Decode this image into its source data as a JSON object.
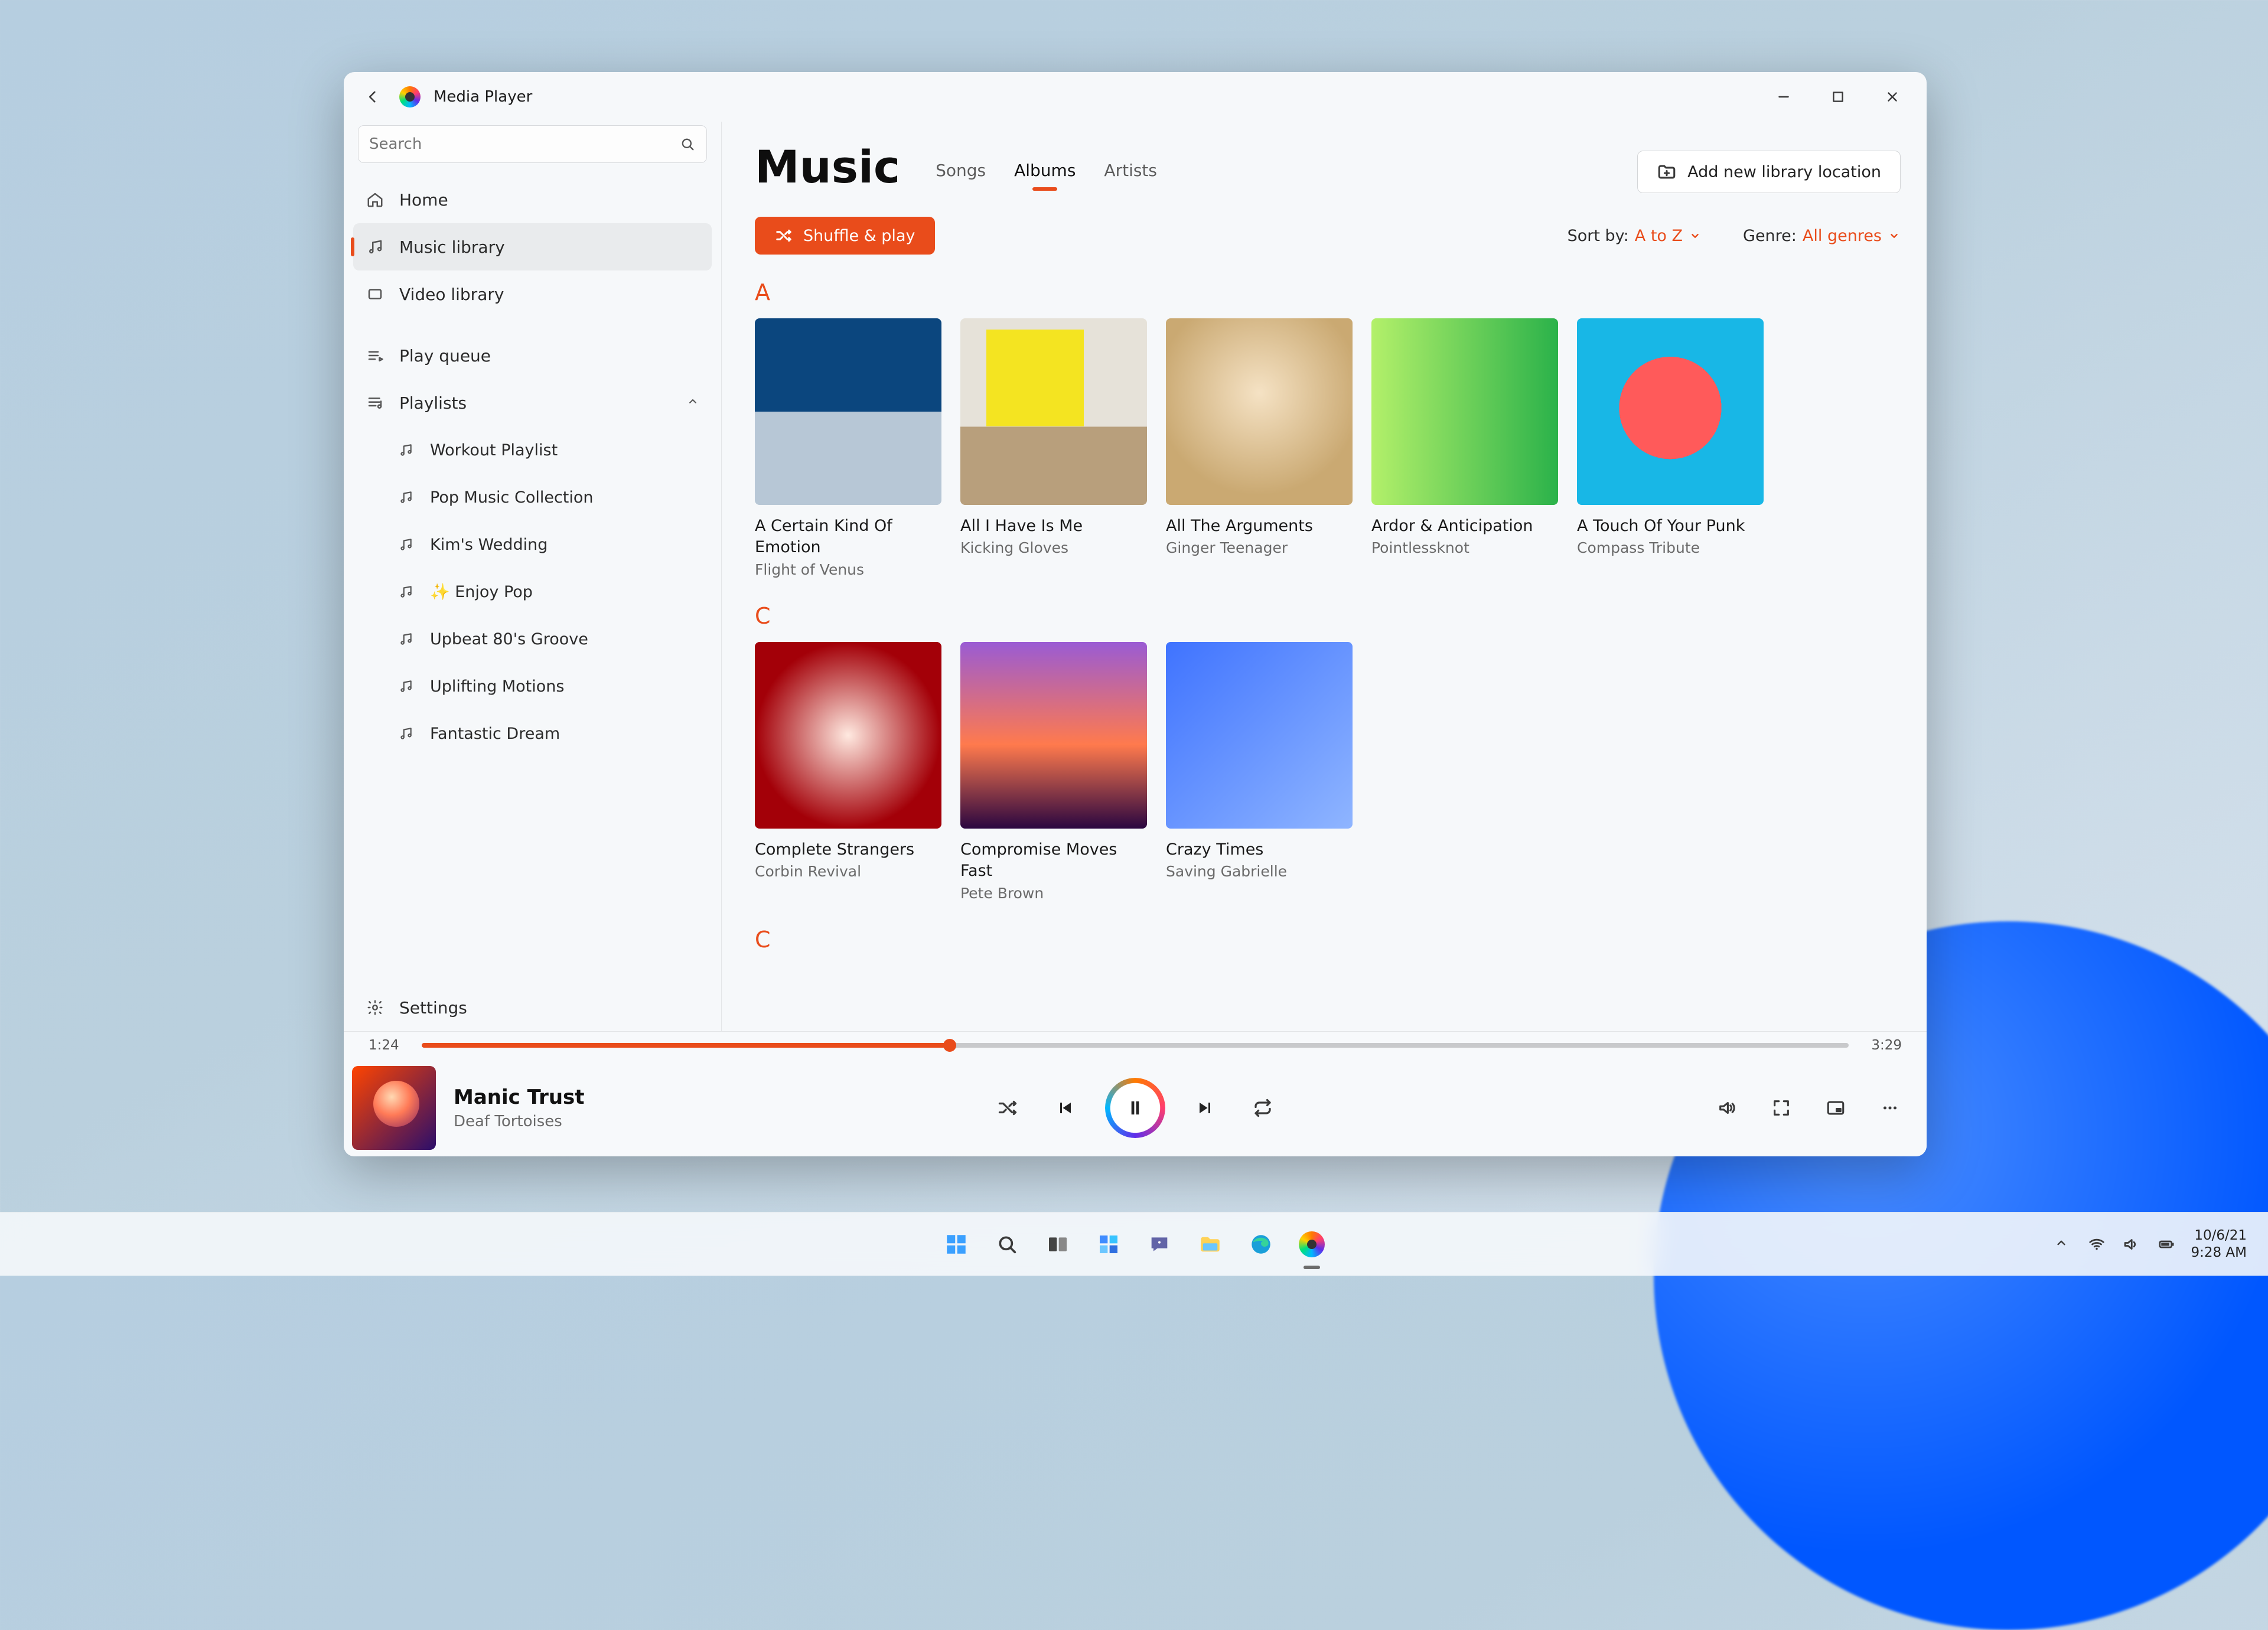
{
  "window": {
    "title": "Media Player"
  },
  "search": {
    "placeholder": "Search"
  },
  "sidebar": {
    "items": [
      {
        "label": "Home"
      },
      {
        "label": "Music library"
      },
      {
        "label": "Video library"
      }
    ],
    "queue": {
      "label": "Play queue"
    },
    "playlists_label": "Playlists",
    "playlists": [
      {
        "label": "Workout Playlist"
      },
      {
        "label": "Pop Music Collection"
      },
      {
        "label": "Kim's Wedding"
      },
      {
        "label": "✨ Enjoy Pop"
      },
      {
        "label": "Upbeat 80's Groove"
      },
      {
        "label": "Uplifting Motions"
      },
      {
        "label": "Fantastic Dream"
      }
    ],
    "settings": "Settings"
  },
  "page": {
    "title": "Music",
    "tabs": [
      "Songs",
      "Albums",
      "Artists"
    ],
    "library_button": "Add new library location",
    "shuffle": "Shuffle & play",
    "sort_by_label": "Sort by:",
    "sort_by_value": "A to Z",
    "genre_label": "Genre:",
    "genre_value": "All genres"
  },
  "groups": [
    {
      "letter": "A",
      "albums": [
        {
          "title": "A Certain Kind Of Emotion",
          "artist": "Flight of Venus"
        },
        {
          "title": "All I Have Is Me",
          "artist": "Kicking Gloves"
        },
        {
          "title": "All The Arguments",
          "artist": "Ginger Teenager"
        },
        {
          "title": "Ardor & Anticipation",
          "artist": "Pointlessknot"
        },
        {
          "title": "A Touch Of Your Punk",
          "artist": "Compass Tribute"
        }
      ]
    },
    {
      "letter": "C",
      "albums": [
        {
          "title": "Complete Strangers",
          "artist": "Corbin Revival"
        },
        {
          "title": "Compromise Moves Fast",
          "artist": "Pete Brown"
        },
        {
          "title": "Crazy Times",
          "artist": "Saving Gabrielle"
        }
      ]
    },
    {
      "letter": "C",
      "albums": []
    }
  ],
  "player": {
    "elapsed": "1:24",
    "duration": "3:29",
    "progress_percent": 37,
    "title": "Manic Trust",
    "artist": "Deaf Tortoises"
  },
  "taskbar": {
    "date": "10/6/21",
    "time": "9:28 AM"
  },
  "colors": {
    "accent": "#e94c1b"
  }
}
